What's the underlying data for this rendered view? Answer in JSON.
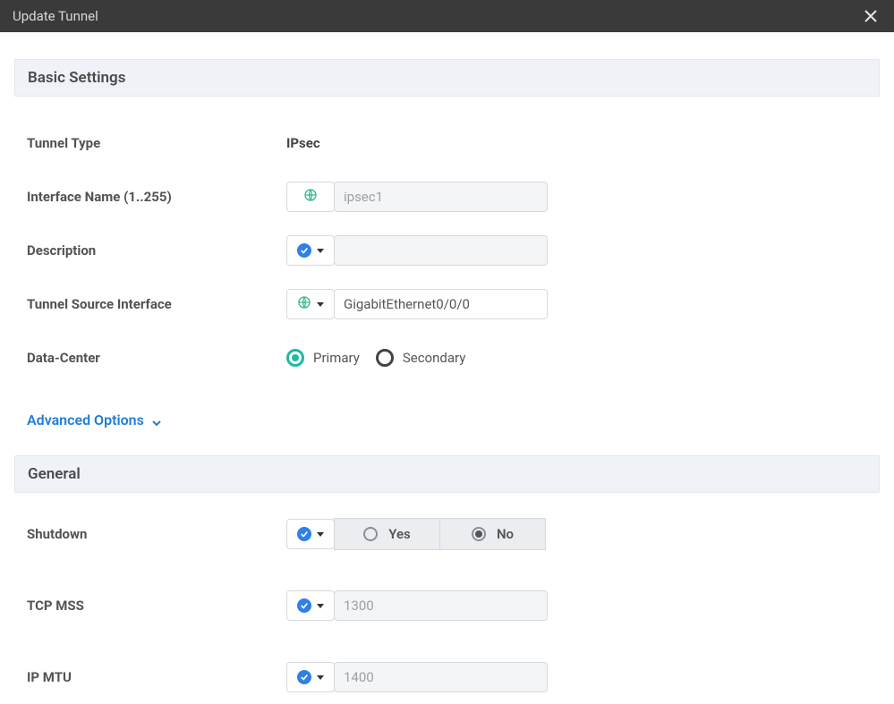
{
  "window": {
    "title": "Update Tunnel"
  },
  "sections": {
    "basic": {
      "title": "Basic Settings",
      "tunnel_type": {
        "label": "Tunnel Type",
        "value": "IPsec"
      },
      "interface_name": {
        "label": "Interface Name (1..255)",
        "placeholder": "ipsec1"
      },
      "description": {
        "label": "Description",
        "value": ""
      },
      "tunnel_source_interface": {
        "label": "Tunnel Source Interface",
        "value": "GigabitEthernet0/0/0"
      },
      "data_center": {
        "label": "Data-Center",
        "option1": "Primary",
        "option2": "Secondary",
        "selected": "Primary"
      }
    },
    "advanced_toggle": "Advanced Options",
    "general": {
      "title": "General",
      "shutdown": {
        "label": "Shutdown",
        "yes": "Yes",
        "no": "No",
        "selected": "No"
      },
      "tcp_mss": {
        "label": "TCP MSS",
        "placeholder": "1300"
      },
      "ip_mtu": {
        "label": "IP MTU",
        "placeholder": "1400"
      }
    }
  }
}
